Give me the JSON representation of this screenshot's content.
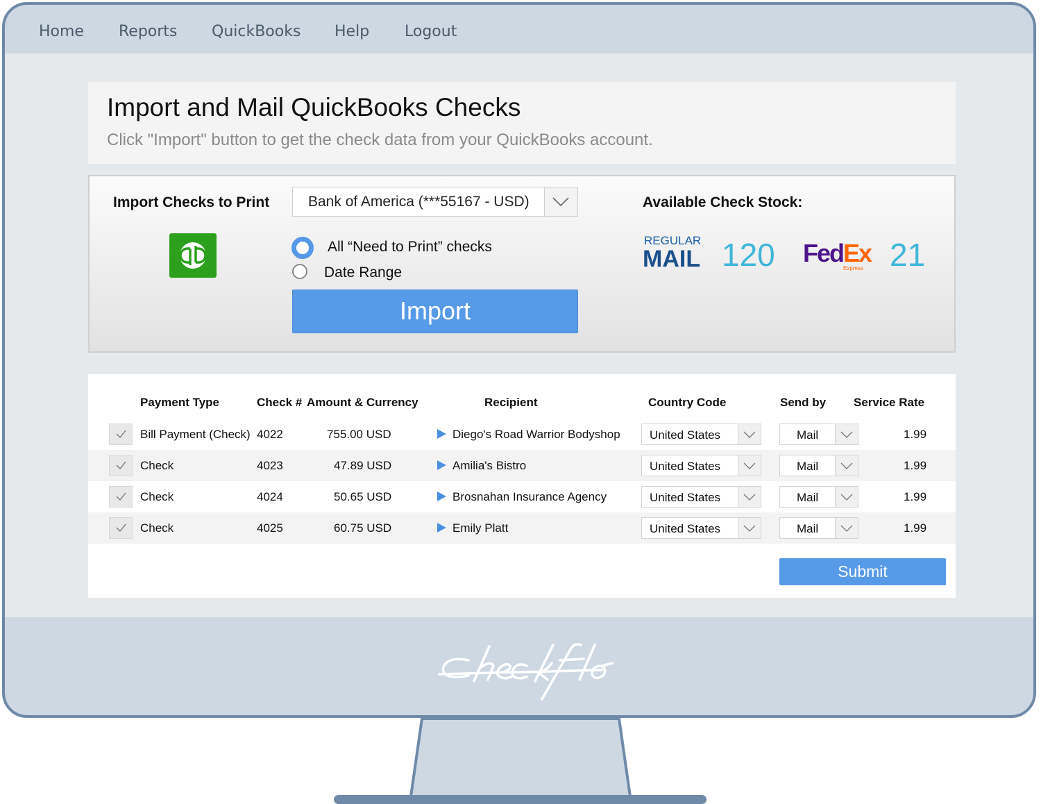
{
  "nav": {
    "items": [
      {
        "label": "Home"
      },
      {
        "label": "Reports"
      },
      {
        "label": "QuickBooks"
      },
      {
        "label": "Help"
      },
      {
        "label": "Logout"
      }
    ]
  },
  "header": {
    "title": "Import and Mail QuickBooks Checks",
    "subtitle": "Click \"Import\" button to get the check data from your QuickBooks account."
  },
  "import": {
    "label": "Import Checks to Print",
    "logo_icon": "quickbooks-logo-icon",
    "account": "Bank of America (***55167 - USD)",
    "options": [
      {
        "label": "All “Need to Print” checks",
        "selected": true
      },
      {
        "label": "Date Range",
        "selected": false
      }
    ],
    "button_label": "Import",
    "accent_color": "#579ae8"
  },
  "stock": {
    "label": "Available Check Stock:",
    "regular_mail": {
      "line1": "REGULAR",
      "line2": "MAIL",
      "count": "120"
    },
    "fedex": {
      "fed": "Fed",
      "ex": "Ex",
      "sub": "Express",
      "count": "21"
    }
  },
  "table": {
    "headers": {
      "payment_type": "Payment Type",
      "check_no": "Check #",
      "amount": "Amount & Currency",
      "recipient": "Recipient",
      "country": "Country Code",
      "send_by": "Send by",
      "rate": "Service Rate"
    },
    "rows": [
      {
        "payment_type": "Bill Payment (Check)",
        "check_no": "4022",
        "amount": "755.00 USD",
        "recipient": "Diego's Road Warrior Bodyshop",
        "country": "United States",
        "send_by": "Mail",
        "rate": "1.99"
      },
      {
        "payment_type": "Check",
        "check_no": "4023",
        "amount": "47.89 USD",
        "recipient": "Amilia's Bistro",
        "country": "United States",
        "send_by": "Mail",
        "rate": "1.99"
      },
      {
        "payment_type": "Check",
        "check_no": "4024",
        "amount": "50.65 USD",
        "recipient": "Brosnahan Insurance Agency",
        "country": "United States",
        "send_by": "Mail",
        "rate": "1.99"
      },
      {
        "payment_type": "Check",
        "check_no": "4025",
        "amount": "60.75 USD",
        "recipient": "Emily Platt",
        "country": "United States",
        "send_by": "Mail",
        "rate": "1.99"
      }
    ],
    "submit_label": "Submit"
  },
  "brand": {
    "logo_text": "checkflo"
  }
}
